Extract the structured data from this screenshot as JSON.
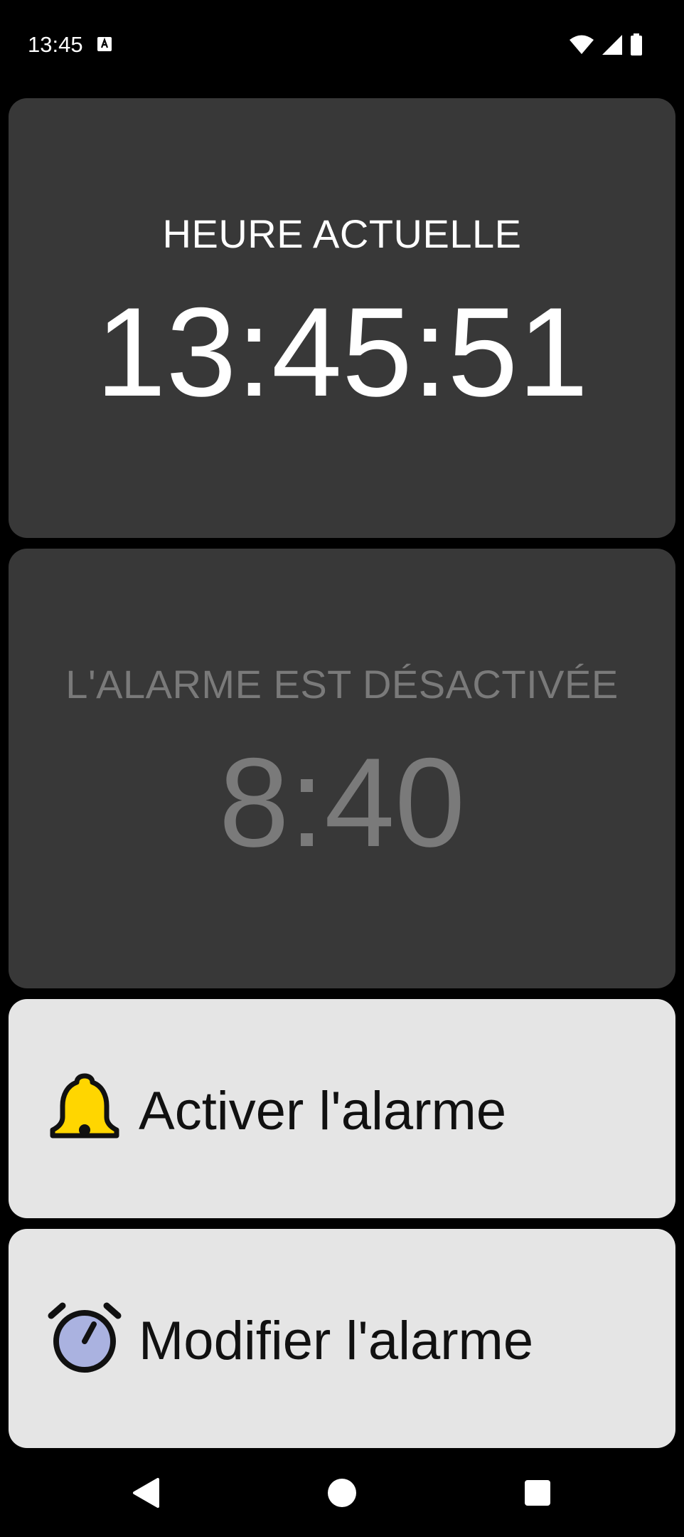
{
  "status_bar": {
    "time": "13:45"
  },
  "current_time_card": {
    "label": "HEURE ACTUELLE",
    "time": "13:45:51"
  },
  "alarm_card": {
    "label": "L'ALARME EST DÉSACTIVÉE",
    "time": "8:40"
  },
  "actions": {
    "activate_label": "Activer l'alarme",
    "modify_label": "Modifier l'alarme"
  },
  "icons": {
    "activate": "bell-icon",
    "modify": "alarm-clock-icon"
  },
  "colors": {
    "background": "#000000",
    "dark_card": "#383838",
    "light_card": "#e5e5e5",
    "disabled_text": "#7a7a7a",
    "bell_yellow": "#ffd600",
    "clock_face": "#aab2e0"
  }
}
